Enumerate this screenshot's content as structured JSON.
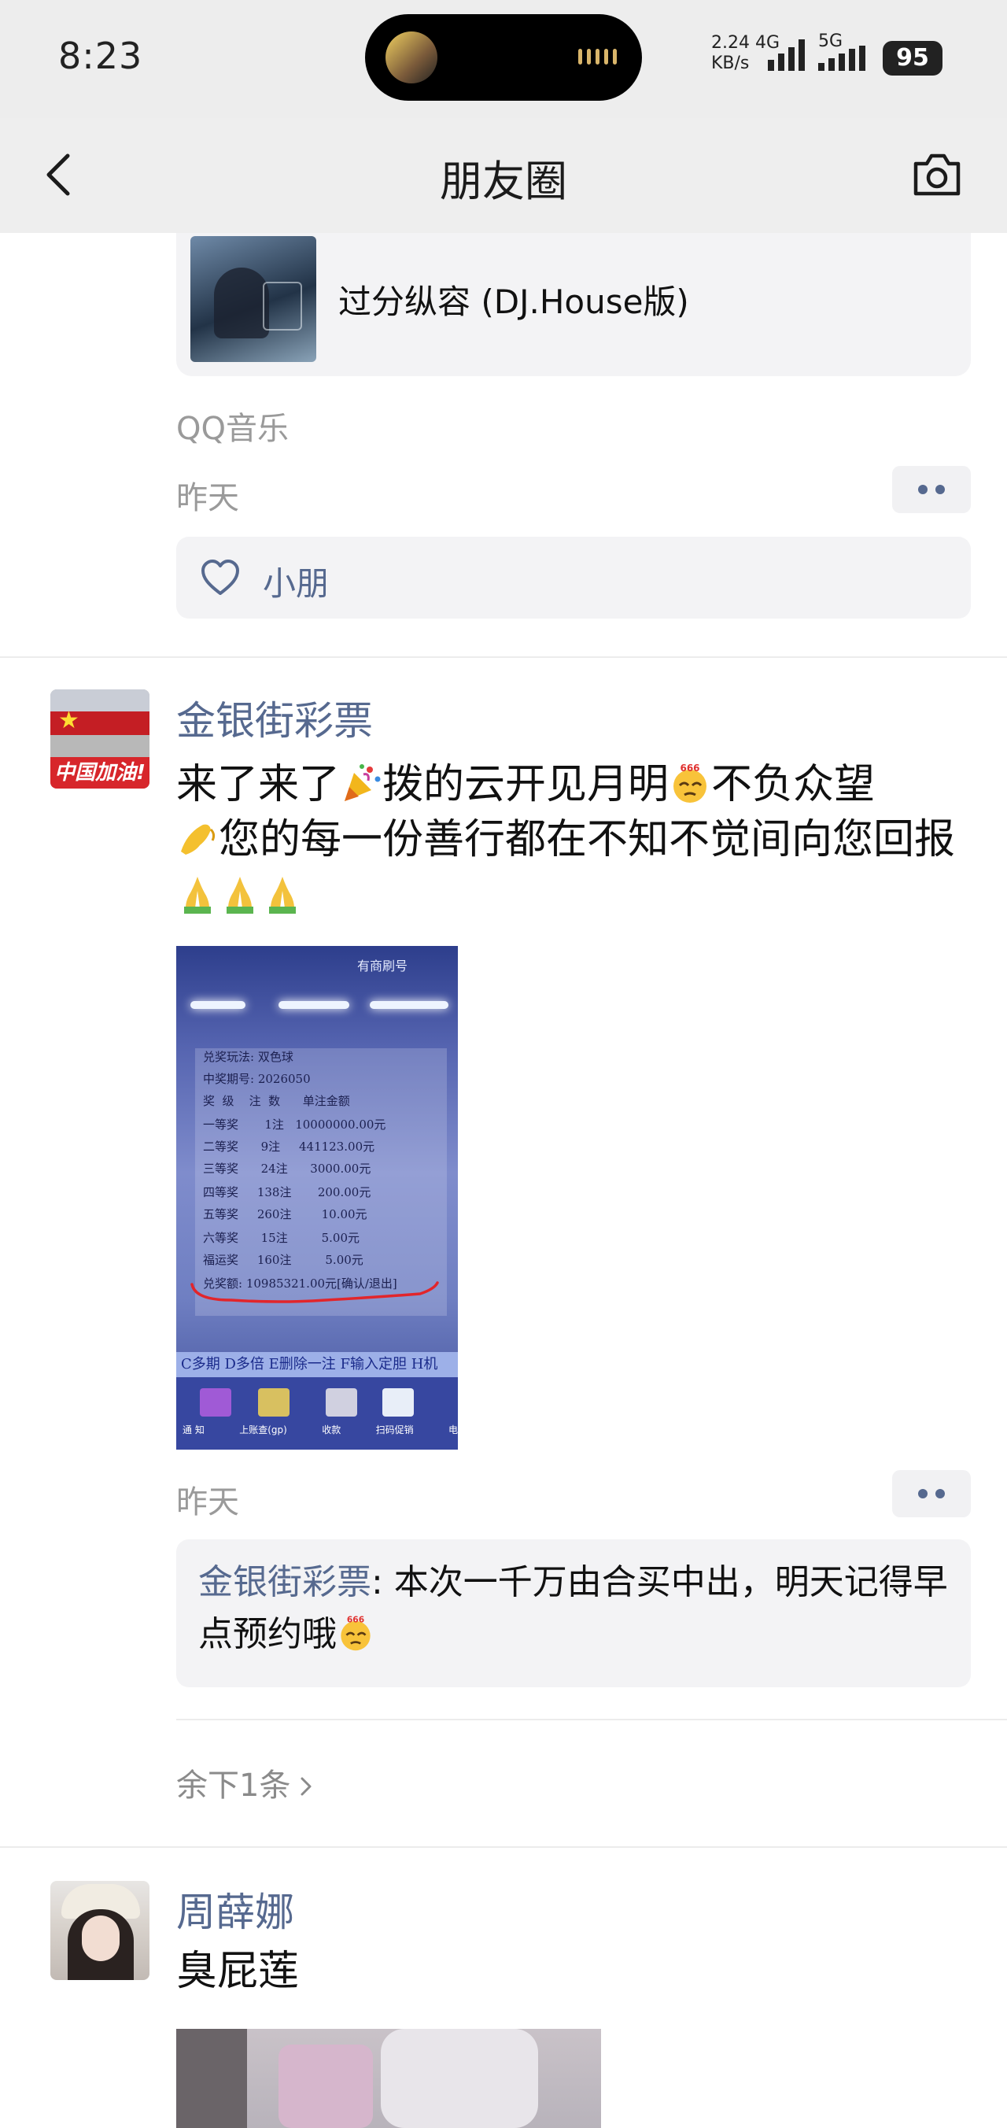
{
  "status_bar": {
    "time": "8:23",
    "net_speed_value": "2.24",
    "net_speed_unit": "KB/s",
    "network_4g": "4G",
    "network_5g": "5G",
    "battery": "95"
  },
  "nav": {
    "title": "朋友圈",
    "back_icon": "chevron-left-icon",
    "camera_icon": "camera-icon"
  },
  "post_prev": {
    "music_title": "过分纵容 (DJ.House版)",
    "source": "QQ音乐",
    "time": "昨天",
    "likes": [
      "小朋"
    ]
  },
  "post_lottery": {
    "author": "金银街彩票",
    "avatar_banner": "中国加油!",
    "text_line1": "来了来了",
    "text_part2": "拨的云开见月明",
    "text_part3": "不负众望",
    "text_part4": "您的每一份善行都在不知不觉间向您回报",
    "photo": {
      "header": "有商刷号",
      "rows": [
        "兑奖玩法: 双色球",
        "中奖期号: 2026050",
        "奖  级    注  数      单注金额",
        "一等奖       1注   10000000.00元",
        "二等奖      9注     441123.00元",
        "三等奖      24注      3000.00元",
        "四等奖     138注       200.00元",
        "五等奖     260注        10.00元",
        "六等奖      15注         5.00元",
        "福运奖     160注         5.00元",
        "兑奖额: 10985321.00元[确认/退出]"
      ],
      "bottom_bar": "C多期 D多倍 E删除一注 F输入定胆 H机",
      "tile_labels": [
        "通 知",
        "上账查(gp)",
        "收款",
        "扫码促销",
        "电"
      ]
    },
    "time": "昨天",
    "comment_author": "金银街彩票",
    "comment_text": ": 本次一千万由合买中出，明天记得早点预约哦",
    "remaining": "余下1条"
  },
  "post_next": {
    "author": "周薛娜",
    "text": "臭屁莲"
  },
  "colors": {
    "link_blue": "#56698f",
    "card_bg": "#f3f3f5",
    "nav_bg": "#ededed"
  }
}
